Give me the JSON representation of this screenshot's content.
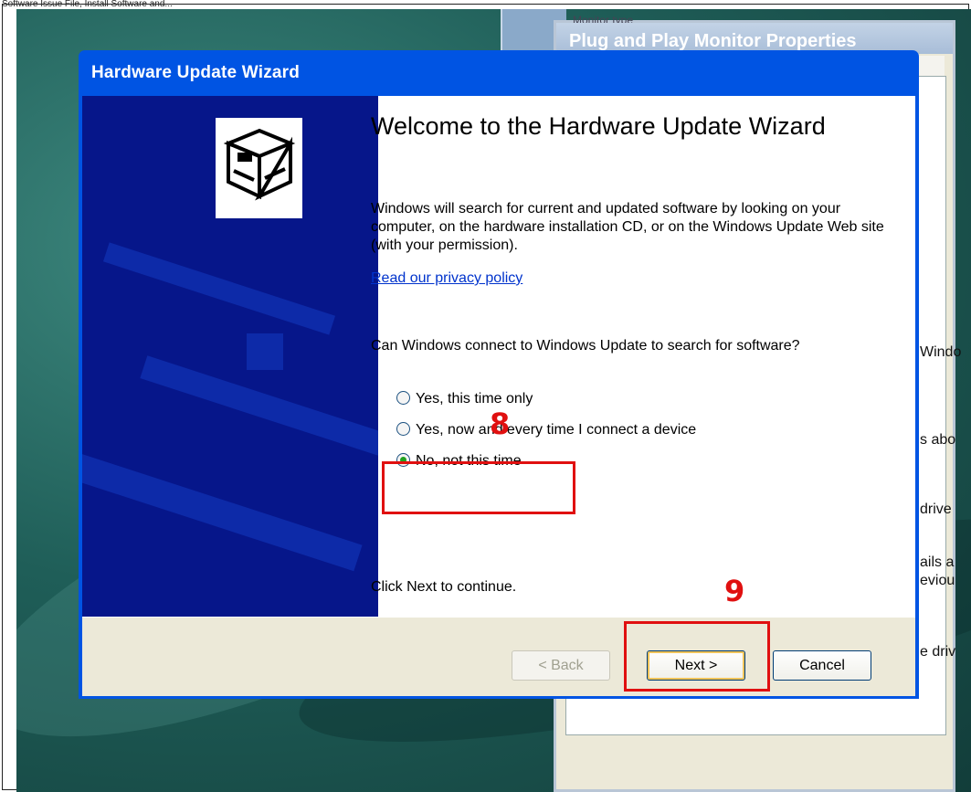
{
  "top_caption": "Software Issue File, Install Software and...",
  "back_window": {
    "top_label": "Monitor type",
    "title": "Plug and Play Monitor Properties",
    "side_texts": [
      "Windo",
      "s abo",
      "drive",
      "ails a",
      "eviou",
      "e driv"
    ]
  },
  "wizard": {
    "title": "Hardware Update Wizard",
    "heading": "Welcome to the Hardware Update Wizard",
    "intro": "Windows will search for current and updated software by looking on your computer, on the hardware installation CD, or on the Windows Update Web site (with your permission).",
    "privacy_link": "Read our privacy policy",
    "question": "Can Windows connect to Windows Update to search for software?",
    "options": [
      {
        "label": "Yes, this time only",
        "selected": false
      },
      {
        "label": "Yes, now and every time I connect a device",
        "selected": false
      },
      {
        "label": "No, not this time",
        "selected": true
      }
    ],
    "continue_text": "Click Next to continue.",
    "buttons": {
      "back": "< Back",
      "next": "Next >",
      "cancel": "Cancel"
    }
  },
  "annotations": {
    "step8": "8",
    "step9": "9"
  },
  "colors": {
    "title_bar": "#0054e3",
    "side_panel": "#06168a",
    "annotation": "#e01010",
    "button_face": "#ece9d8"
  }
}
